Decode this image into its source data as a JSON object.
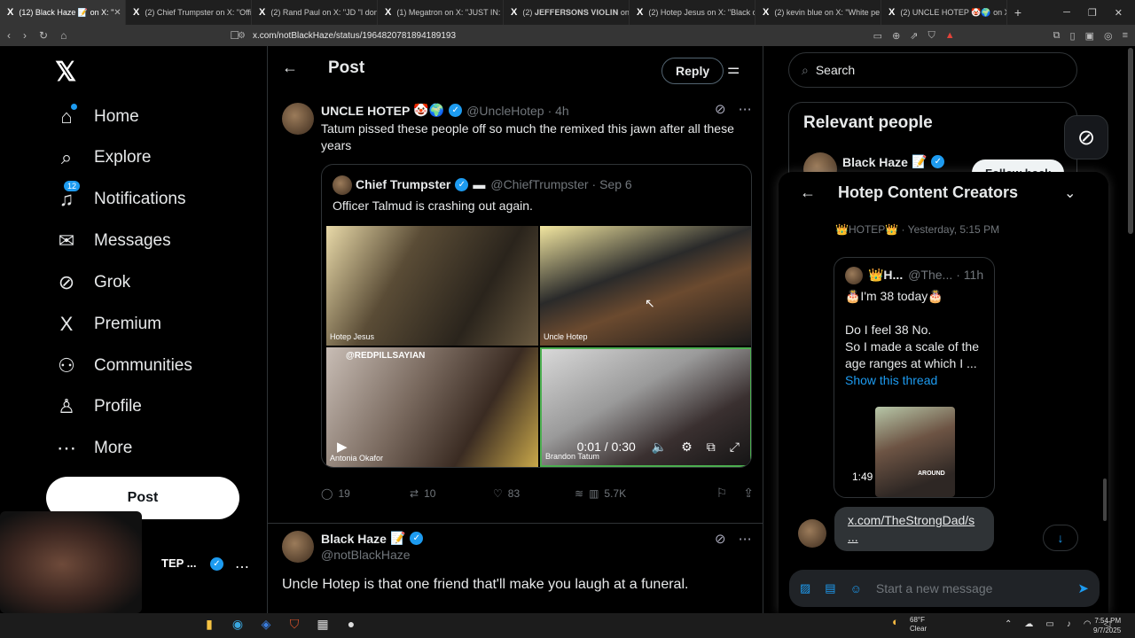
{
  "browser": {
    "tabs": [
      {
        "label": "(12) Black Haze 📝 on X: \"",
        "active": true
      },
      {
        "label": "(2) Chief Trumpster on X: \"Offi",
        "active": false
      },
      {
        "label": "(2) Rand Paul on X: \"JD \"I don't",
        "active": false
      },
      {
        "label": "(1) Megatron on X: \"JUST IN: JI",
        "active": false
      },
      {
        "label": "(2) 𝐉𝐄𝐅𝐅𝐄𝐑𝐒𝐎𝐍𝐒 𝐕𝐈𝐎𝐋𝐈𝐍 on",
        "active": false
      },
      {
        "label": "(2) Hotep Jesus on X: \"Black on",
        "active": false
      },
      {
        "label": "(2) kevin blue on X: \"White pe",
        "active": false
      },
      {
        "label": "(2) UNCLE HOTEP 🤡🌍 on X:",
        "active": false
      }
    ],
    "url": "x.com/notBlackHaze/status/1964820781894189193"
  },
  "sidebar": {
    "items": [
      {
        "label": "Home",
        "icon": "home-icon",
        "glyph": "⌂"
      },
      {
        "label": "Explore",
        "icon": "search-icon",
        "glyph": "⌕"
      },
      {
        "label": "Notifications",
        "icon": "bell-icon",
        "glyph": "⍾",
        "badge": "12"
      },
      {
        "label": "Messages",
        "icon": "mail-icon",
        "glyph": "✉"
      },
      {
        "label": "Grok",
        "icon": "grok-icon",
        "glyph": "⊘"
      },
      {
        "label": "Premium",
        "icon": "x-premium-icon",
        "glyph": "𝕏"
      },
      {
        "label": "Communities",
        "icon": "communities-icon",
        "glyph": "♟"
      },
      {
        "label": "Profile",
        "icon": "profile-icon",
        "glyph": "♙"
      },
      {
        "label": "More",
        "icon": "more-icon",
        "glyph": "⋯"
      }
    ],
    "post_label": "Post",
    "account_name": "TEP ..."
  },
  "main": {
    "title": "Post",
    "reply_label": "Reply",
    "tweet1": {
      "name": "UNCLE HOTEP",
      "emoji": "🤡🌍",
      "handle": "@UncleHotep",
      "time": "· 4h",
      "text": "Tatum pissed these people off so much the remixed this jawn after all these years"
    },
    "quote": {
      "name": "Chief Trumpster",
      "flag": "▬",
      "handle": "@ChiefTrumpster",
      "date": "· Sep 6",
      "text": "Officer Talmud is crashing out again.",
      "video_labels": [
        "Hotep Jesus",
        "Uncle Hotep",
        "Antonia Okafor",
        "Brandon Tatum"
      ],
      "video_top_label": "@REDPILLSAYIAN",
      "time": "0:01 / 0:30"
    },
    "stats": {
      "replies": "19",
      "reposts": "10",
      "likes": "83",
      "views": "5.7K"
    },
    "tweet2": {
      "name": "Black Haze",
      "emoji": "📝",
      "handle": "@notBlackHaze",
      "text": "Uncle Hotep is that one friend that'll make you laugh at a funeral."
    }
  },
  "right": {
    "search_placeholder": "Search",
    "relevant_title": "Relevant people",
    "relevant_name": "Black Haze",
    "relevant_emoji": "📝",
    "follow_back": "Follow back"
  },
  "dm": {
    "title": "Hotep Content Creators",
    "sender_line": "👑HOTEP👑 · Yesterday, 5:15 PM",
    "card_name": "👑H...",
    "card_handle": "@The...",
    "card_time": "· 11h",
    "card_line1": "🎂I'm 38 today🎂",
    "card_body": "Do I feel 38 No.\nSo I made a scale of the age ranges at which I ...",
    "show_thread": "Show this thread",
    "video_duration": "1:49",
    "video_caption": "AROUND",
    "link_text": "x.com/TheStrongDad/s ...",
    "compose_placeholder": "Start a new message"
  },
  "taskbar": {
    "temp": "68°F",
    "weather": "Clear",
    "time": "7:54 PM",
    "date": "9/7/2025"
  }
}
